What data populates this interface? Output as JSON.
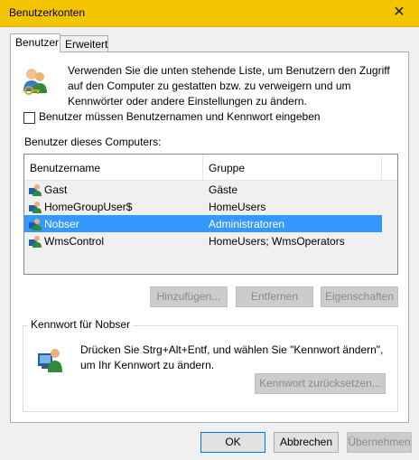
{
  "window": {
    "title": "Benutzerkonten",
    "close_glyph": "✕"
  },
  "tabs": [
    {
      "label": "Benutzer",
      "active": true
    },
    {
      "label": "Erweitert",
      "active": false
    }
  ],
  "intro": {
    "icon": "users-keys-icon",
    "text": "Verwenden Sie die unten stehende Liste, um Benutzern den Zugriff auf den Computer zu gestatten bzw. zu verweigern und um Kennwörter oder andere Einstellungen zu ändern."
  },
  "require_password": {
    "label": "Benutzer müssen Benutzernamen und Kennwort eingeben",
    "checked": false
  },
  "users": {
    "label": "Benutzer dieses Computers:",
    "columns": [
      "Benutzername",
      "Gruppe"
    ],
    "rows": [
      {
        "name": "Gast",
        "group": "Gäste",
        "selected": false
      },
      {
        "name": "HomeGroupUser$",
        "group": "HomeUsers",
        "selected": false
      },
      {
        "name": "Nobser",
        "group": "Administratoren",
        "selected": true
      },
      {
        "name": "WmsControl",
        "group": "HomeUsers; WmsOperators",
        "selected": false
      }
    ],
    "selection_color": "#3399ff"
  },
  "list_buttons": {
    "add": "Hinzufügen...",
    "remove": "Entfernen",
    "properties": "Eigenschaften"
  },
  "password_group": {
    "title": "Kennwort für Nobser",
    "text": "Drücken Sie Strg+Alt+Entf, und wählen Sie \"Kennwort ändern\", um Ihr Kennwort zu ändern.",
    "reset_button": "Kennwort zurücksetzen..."
  },
  "dialog_buttons": {
    "ok": "OK",
    "cancel": "Abbrechen",
    "apply": "Übernehmen"
  },
  "colors": {
    "titlebar": "#f5c400",
    "accent": "#0078d7"
  }
}
